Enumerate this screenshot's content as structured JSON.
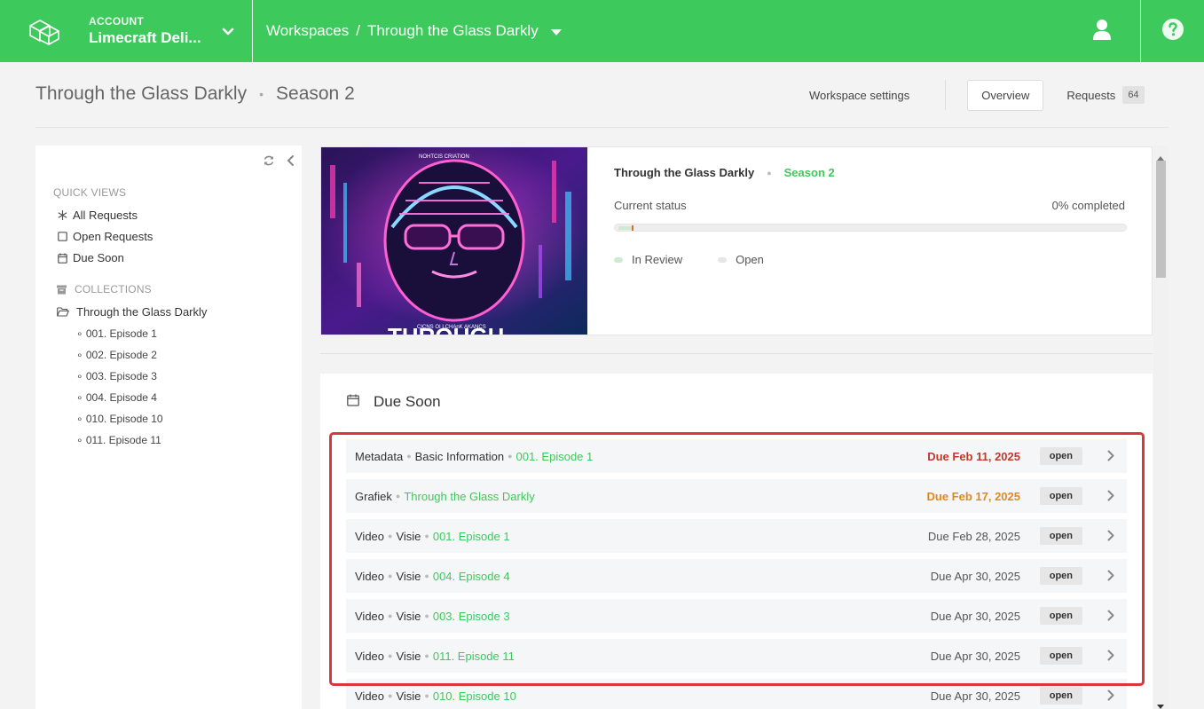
{
  "topbar": {
    "account_label": "ACCOUNT",
    "account_name": "Limecraft Deli...",
    "breadcrumb_root": "Workspaces",
    "breadcrumb_sep": "/",
    "breadcrumb_current": "Through the Glass Darkly",
    "brand_color": "#3ec95c"
  },
  "header": {
    "title": "Through the Glass Darkly",
    "subtitle": "Season 2",
    "workspace_settings": "Workspace settings",
    "overview": "Overview",
    "requests": "Requests",
    "requests_count": "64"
  },
  "sidebar": {
    "quick_views_heading": "QUICK VIEWS",
    "quick_views": [
      "All Requests",
      "Open Requests",
      "Due Soon"
    ],
    "collections_heading": "COLLECTIONS",
    "collection_root": "Through the Glass Darkly",
    "episodes": [
      "001. Episode 1",
      "002. Episode 2",
      "003. Episode 3",
      "004. Episode 4",
      "010. Episode 10",
      "011. Episode 11"
    ]
  },
  "info": {
    "title": "Through the Glass Darkly",
    "season": "Season 2",
    "status_label": "Current status",
    "percent_label": "0% completed",
    "progress_fraction": 0.0,
    "legend_in_review": "In Review",
    "legend_open": "Open",
    "cover_top_text": "NOHTCIS CRIATION",
    "cover_mid_text": "CICNS OI LCHAnK AKANCS",
    "cover_bottom_text": "THROUGH"
  },
  "due": {
    "heading": "Due Soon",
    "rows": [
      {
        "a": "Metadata",
        "b": "Basic Information",
        "c": "001. Episode 1",
        "date": "Due Feb 11, 2025",
        "status": "open"
      },
      {
        "a": "Grafiek",
        "b": "",
        "c": "Through the Glass Darkly",
        "date": "Due Feb 17, 2025",
        "status": "open"
      },
      {
        "a": "Video",
        "b": "Visie",
        "c": "001. Episode 1",
        "date": "Due Feb 28, 2025",
        "status": "open"
      },
      {
        "a": "Video",
        "b": "Visie",
        "c": "004. Episode 4",
        "date": "Due Apr 30, 2025",
        "status": "open"
      },
      {
        "a": "Video",
        "b": "Visie",
        "c": "003. Episode 3",
        "date": "Due Apr 30, 2025",
        "status": "open"
      },
      {
        "a": "Video",
        "b": "Visie",
        "c": "011. Episode 11",
        "date": "Due Apr 30, 2025",
        "status": "open"
      },
      {
        "a": "Video",
        "b": "Visie",
        "c": "010. Episode 10",
        "date": "Due Apr 30, 2025",
        "status": "open"
      }
    ]
  }
}
